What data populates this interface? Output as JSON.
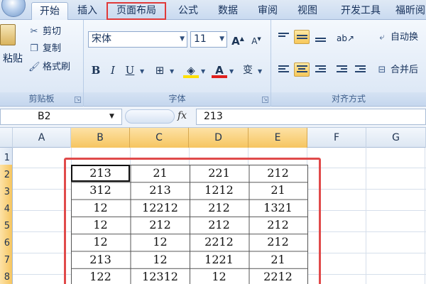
{
  "tabs": [
    {
      "label": "开始",
      "active": true
    },
    {
      "label": "插入"
    },
    {
      "label": "页面布局",
      "highlighted": true
    },
    {
      "label": "公式"
    },
    {
      "label": "数据"
    },
    {
      "label": "审阅"
    },
    {
      "label": "视图"
    },
    {
      "label": "开发工具"
    },
    {
      "label": "福昕阅"
    }
  ],
  "clipboard": {
    "paste_label": "粘贴",
    "cut_label": "剪切",
    "copy_label": "复制",
    "format_painter_label": "格式刷",
    "group_label": "剪贴板"
  },
  "font": {
    "font_name": "宋体",
    "font_size": "11",
    "group_label": "字体",
    "phonetic_glyph": "变"
  },
  "alignment": {
    "wrap_label": "自动换",
    "merge_label": "合并后",
    "group_label": "对齐方式"
  },
  "formula_bar": {
    "name_box": "B2",
    "fx_label": "fx",
    "formula_value": "213"
  },
  "sheet": {
    "columns": [
      "A",
      "B",
      "C",
      "D",
      "E",
      "F",
      "G"
    ],
    "rows": [
      "1",
      "2",
      "3",
      "4",
      "5",
      "6",
      "7",
      "8"
    ],
    "selected_columns": [
      "B",
      "C",
      "D",
      "E"
    ],
    "data": [
      [
        "213",
        "21",
        "221",
        "212"
      ],
      [
        "312",
        "213",
        "1212",
        "21"
      ],
      [
        "12",
        "12212",
        "212",
        "1321"
      ],
      [
        "12",
        "212",
        "212",
        "212"
      ],
      [
        "12",
        "12",
        "2212",
        "212"
      ],
      [
        "213",
        "12",
        "1221",
        "21"
      ],
      [
        "122",
        "12312",
        "12",
        "2212"
      ]
    ]
  },
  "colors": {
    "highlight_red": "#e04a4a",
    "selected_header": "#f6c560",
    "ribbon_bg": "#dde8f6"
  }
}
